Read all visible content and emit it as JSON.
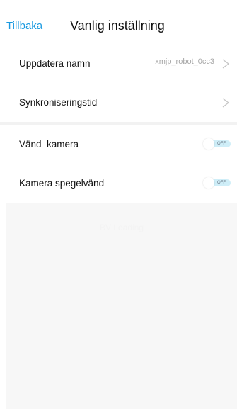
{
  "header": {
    "back_label": "Tillbaka",
    "title": "Vanlig inställning"
  },
  "settings": {
    "rename": {
      "label": "Uppdatera namn",
      "value": "xmjp_robot_0cc3"
    },
    "sync_time": {
      "label": "Synkroniseringstid"
    },
    "flip_camera": {
      "label": "Vänd  kamera",
      "state": "OFF"
    },
    "mirror_camera": {
      "label": "Kamera spegelvänd",
      "state": "OFF"
    }
  },
  "panel": {
    "faint_text": "BV Loading"
  },
  "colors": {
    "accent": "#1a9ae0",
    "toggle_track": "#cfeef8",
    "panel_bg": "#f7f7f7"
  }
}
